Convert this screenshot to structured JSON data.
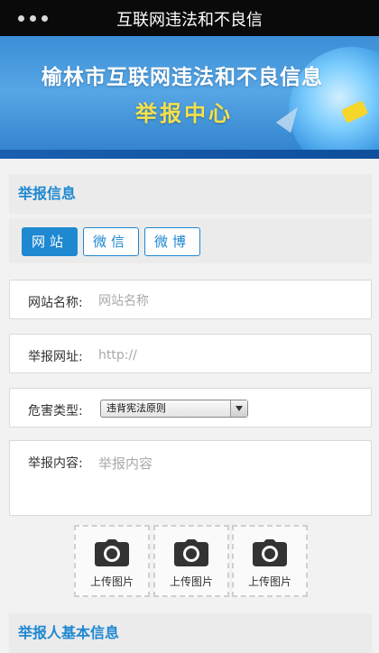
{
  "topbar": {
    "title": "互联网违法和不良信"
  },
  "banner": {
    "line1": "榆林市互联网违法和不良信息",
    "line2": "举报中心"
  },
  "section1": {
    "title": "举报信息"
  },
  "tabs": [
    {
      "label": "网站",
      "active": true
    },
    {
      "label": "微信",
      "active": false
    },
    {
      "label": "微博",
      "active": false
    }
  ],
  "fields": {
    "site_name": {
      "label": "网站名称:",
      "placeholder": "网站名称"
    },
    "site_url": {
      "label": "举报网址:",
      "placeholder": "http://"
    },
    "harm_type": {
      "label": "危害类型:",
      "selected": "违背宪法原则"
    },
    "content": {
      "label": "举报内容:",
      "placeholder": "举报内容"
    }
  },
  "uploads": [
    {
      "label": "上传图片",
      "icon": "camera-icon"
    },
    {
      "label": "上传图片",
      "icon": "camera-icon"
    },
    {
      "label": "上传图片",
      "icon": "camera-icon"
    }
  ],
  "section2": {
    "title": "举报人基本信息"
  },
  "colors": {
    "accent": "#1e88d1",
    "banner_title": "#ffffff",
    "banner_subtitle": "#f5e14a"
  }
}
